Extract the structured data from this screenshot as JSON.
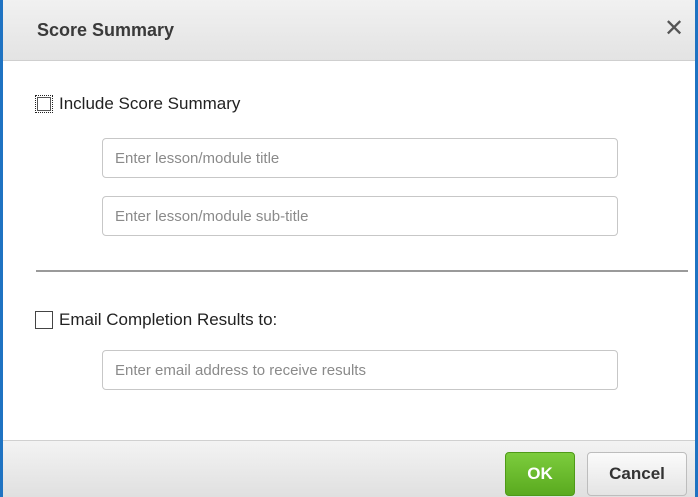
{
  "dialog": {
    "title": "Score Summary",
    "close_glyph": "✕"
  },
  "score_summary": {
    "checkbox_label": "Include Score Summary",
    "checked": false,
    "title_placeholder": "Enter lesson/module title",
    "title_value": "",
    "subtitle_placeholder": "Enter lesson/module sub-title",
    "subtitle_value": ""
  },
  "email": {
    "checkbox_label": "Email Completion Results to:",
    "checked": false,
    "address_placeholder": "Enter email address to receive results",
    "address_value": ""
  },
  "footer": {
    "ok_label": "OK",
    "cancel_label": "Cancel"
  },
  "colors": {
    "frame_blue": "#1f73c2",
    "ok_green": "#5aaa1f"
  }
}
